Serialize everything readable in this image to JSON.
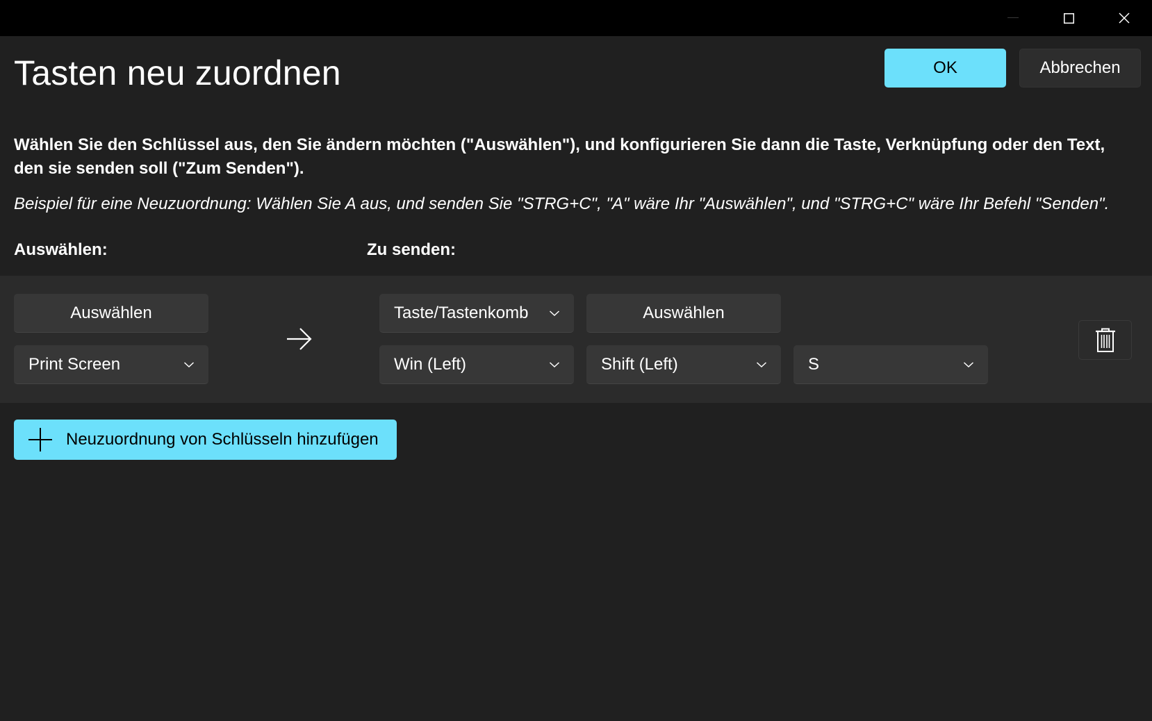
{
  "dialog": {
    "title": "Tasten neu zuordnen",
    "ok_label": "OK",
    "cancel_label": "Abbrechen",
    "description": "Wählen Sie den Schlüssel aus, den Sie ändern möchten (\"Auswählen\"), und konfigurieren Sie dann die Taste, Verknüpfung oder den Text, den sie senden soll (\"Zum Senden\").",
    "example": "Beispiel für eine Neuzuordnung: Wählen Sie A aus, und senden Sie \"STRG+C\", \"A\" wäre Ihr \"Auswählen\", und \"STRG+C\" wäre Ihr Befehl \"Senden\"."
  },
  "columns": {
    "select_header": "Auswählen:",
    "send_header": "Zu senden:"
  },
  "mapping": {
    "source_select_button": "Auswählen",
    "source_key": "Print Screen",
    "target_type": "Taste/Tastenkomb",
    "target_select_button": "Auswählen",
    "target_keys": [
      "Win (Left)",
      "Shift (Left)",
      "S"
    ]
  },
  "add_button_label": "Neuzuordnung von Schlüsseln hinzufügen",
  "colors": {
    "accent": "#6ce0fb",
    "background": "#202020",
    "row_background": "#2b2b2b",
    "control_background": "#373737",
    "titlebar": "#000000"
  },
  "icons": [
    "minimize-icon",
    "maximize-icon",
    "close-icon",
    "arrow-right-icon",
    "chevron-down-icon",
    "trash-icon",
    "plus-icon"
  ]
}
